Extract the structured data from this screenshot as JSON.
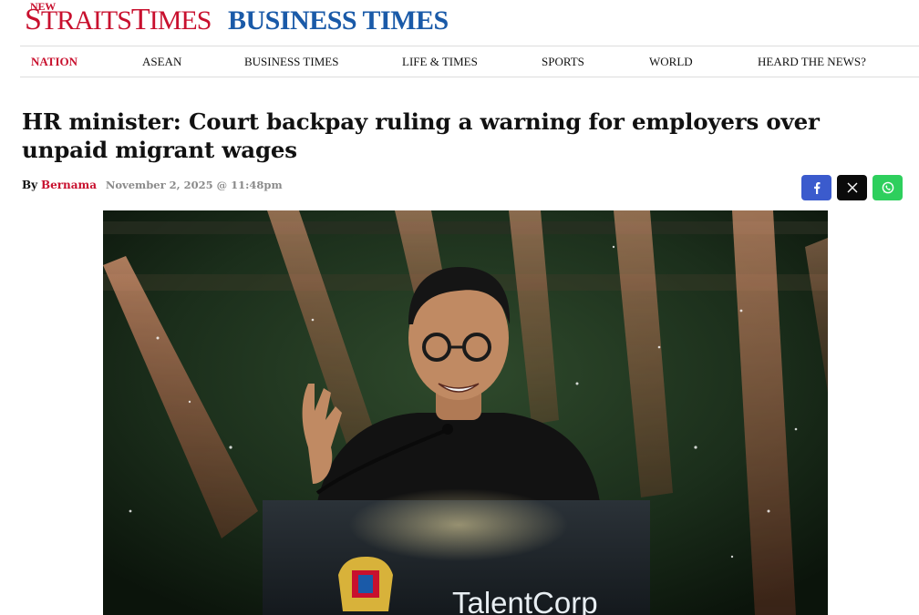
{
  "header": {
    "nst_logo": {
      "small": "NEW",
      "main_first": "S",
      "main_mid": "TRAITS",
      "main_t": "T",
      "main_last": "IMES"
    },
    "bt_logo": "BUSINESS TIMES"
  },
  "nav": {
    "items": [
      {
        "label": "NATION",
        "active": true
      },
      {
        "label": "ASEAN"
      },
      {
        "label": "BUSINESS TIMES"
      },
      {
        "label": "LIFE & TIMES"
      },
      {
        "label": "SPORTS"
      },
      {
        "label": "WORLD"
      },
      {
        "label": "HEARD THE NEWS?"
      }
    ]
  },
  "article": {
    "headline": "HR minister: Court backpay ruling a warning for employers over unpaid migrant wages",
    "by_label": "By",
    "author": "Bernama",
    "date": "November 2, 2025 @ 11:48pm"
  },
  "share": {
    "facebook_icon": "facebook-icon",
    "x_icon": "x-icon",
    "whatsapp_icon": "whatsapp-icon",
    "colors": {
      "facebook": "#3b5bcd",
      "x": "#0b0b0b",
      "whatsapp": "#2ecf5d"
    }
  },
  "photo": {
    "podium_text": "TalentCorp"
  },
  "colors": {
    "brand_red": "#c8102e",
    "brand_blue": "#1a5aa8"
  }
}
